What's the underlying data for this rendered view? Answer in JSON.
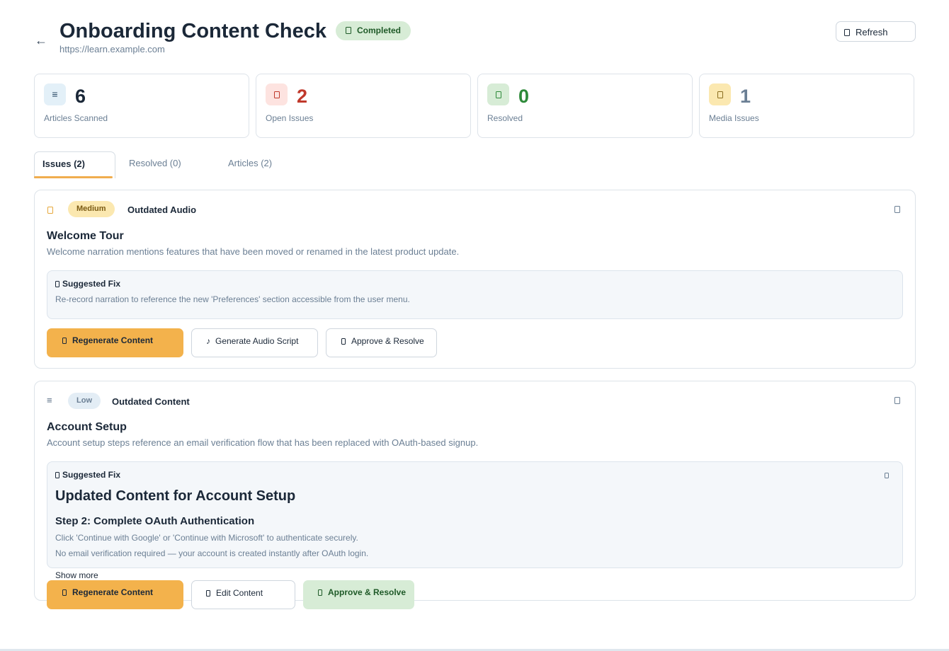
{
  "header": {
    "back_icon": "←",
    "title": "Onboarding Content Check",
    "status": "Completed",
    "url": "https://learn.example.com",
    "refresh_label": "Refresh"
  },
  "stats": [
    {
      "value": "6",
      "label": "Articles Scanned",
      "icon": "list-icon",
      "glyph": "≡",
      "color": "#1b2838",
      "icon_bg": "#e3f0f8"
    },
    {
      "value": "2",
      "label": "Open Issues",
      "icon": "alert-icon",
      "color": "#c0392b",
      "icon_bg": "#fde3e0"
    },
    {
      "value": "0",
      "label": "Resolved",
      "icon": "check-icon",
      "color": "#2e8a3a",
      "icon_bg": "#d7ecd6"
    },
    {
      "value": "1",
      "label": "Media Issues",
      "icon": "audio-icon",
      "color": "#6b7f94",
      "icon_bg": "#fbe8b0"
    }
  ],
  "tabs": [
    {
      "label": "Issues (2)"
    },
    {
      "label": "Resolved (0)"
    },
    {
      "label": "Articles (2)"
    }
  ],
  "issues": [
    {
      "severity": "Medium",
      "type": "Outdated Audio",
      "type_icon": "audio-icon",
      "article": "Welcome Tour",
      "description": "Welcome narration mentions features that have been moved or renamed in the latest product update.",
      "fix_label": "Suggested Fix",
      "fix_text": "Re-record narration to reference the new 'Preferences' section accessible from the user menu.",
      "actions": [
        "Regenerate Content",
        "Generate Audio Script",
        "Approve & Resolve"
      ],
      "audio_glyph": "♪"
    },
    {
      "severity": "Low",
      "type": "Outdated Content",
      "type_icon": "list-icon",
      "type_glyph": "≡",
      "article": "Account Setup",
      "description": "Account setup steps reference an email verification flow that has been replaced with OAuth-based signup.",
      "fix_label": "Suggested Fix",
      "fix_heading": "Updated Content for Account Setup",
      "fix_subheading": "Step 2: Complete OAuth Authentication",
      "fix_lines": [
        "Click 'Continue with Google' or 'Continue with Microsoft' to authenticate securely.",
        "No email verification required — your account is created instantly after OAuth login."
      ],
      "show_more": "Show more",
      "actions": [
        "Regenerate Content",
        "Edit Content",
        "Approve & Resolve"
      ]
    }
  ],
  "colors": {
    "accent": "#f3b24c",
    "success_bg": "#d7ecd6",
    "medium_bg": "#fbe8b0",
    "low_bg": "#e3edf5"
  }
}
